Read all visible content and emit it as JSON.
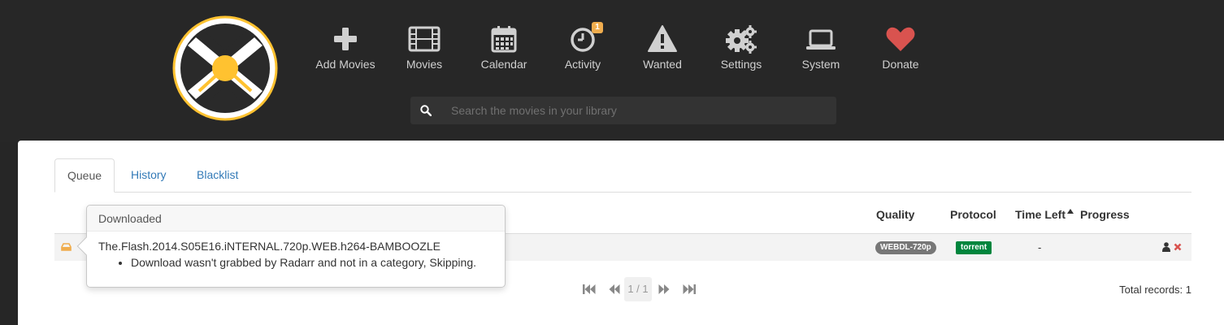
{
  "nav": {
    "items": [
      {
        "label": "Add Movies",
        "icon": "plus-icon"
      },
      {
        "label": "Movies",
        "icon": "film-icon"
      },
      {
        "label": "Calendar",
        "icon": "calendar-icon"
      },
      {
        "label": "Activity",
        "icon": "clock-icon",
        "badge": "1"
      },
      {
        "label": "Wanted",
        "icon": "warning-icon"
      },
      {
        "label": "Settings",
        "icon": "cogs-icon"
      },
      {
        "label": "System",
        "icon": "laptop-icon"
      },
      {
        "label": "Donate",
        "icon": "heart-icon"
      }
    ]
  },
  "search": {
    "placeholder": "Search the movies in your library"
  },
  "tabs": [
    {
      "label": "Queue"
    },
    {
      "label": "History"
    },
    {
      "label": "Blacklist"
    }
  ],
  "table": {
    "headers": {
      "quality": "Quality",
      "protocol": "Protocol",
      "time_left": "Time Left",
      "progress": "Progress"
    },
    "rows": [
      {
        "quality": "WEBDL-720p",
        "protocol": "torrent",
        "time_left": "-"
      }
    ]
  },
  "popover": {
    "title": "Downloaded",
    "release": "The.Flash.2014.S05E16.iNTERNAL.720p.WEB.h264-BAMBOOZLE",
    "message": "Download wasn't grabbed by Radarr and not in a category, Skipping."
  },
  "pager": {
    "page": "1 / 1"
  },
  "total_records": "Total records: 1",
  "colors": {
    "header_bg": "#272727",
    "accent_yellow": "#ffc230",
    "quality_pill": "#777777",
    "protocol_pill": "#00853d",
    "heart": "#d9534f",
    "badge": "#f0ad4e"
  }
}
